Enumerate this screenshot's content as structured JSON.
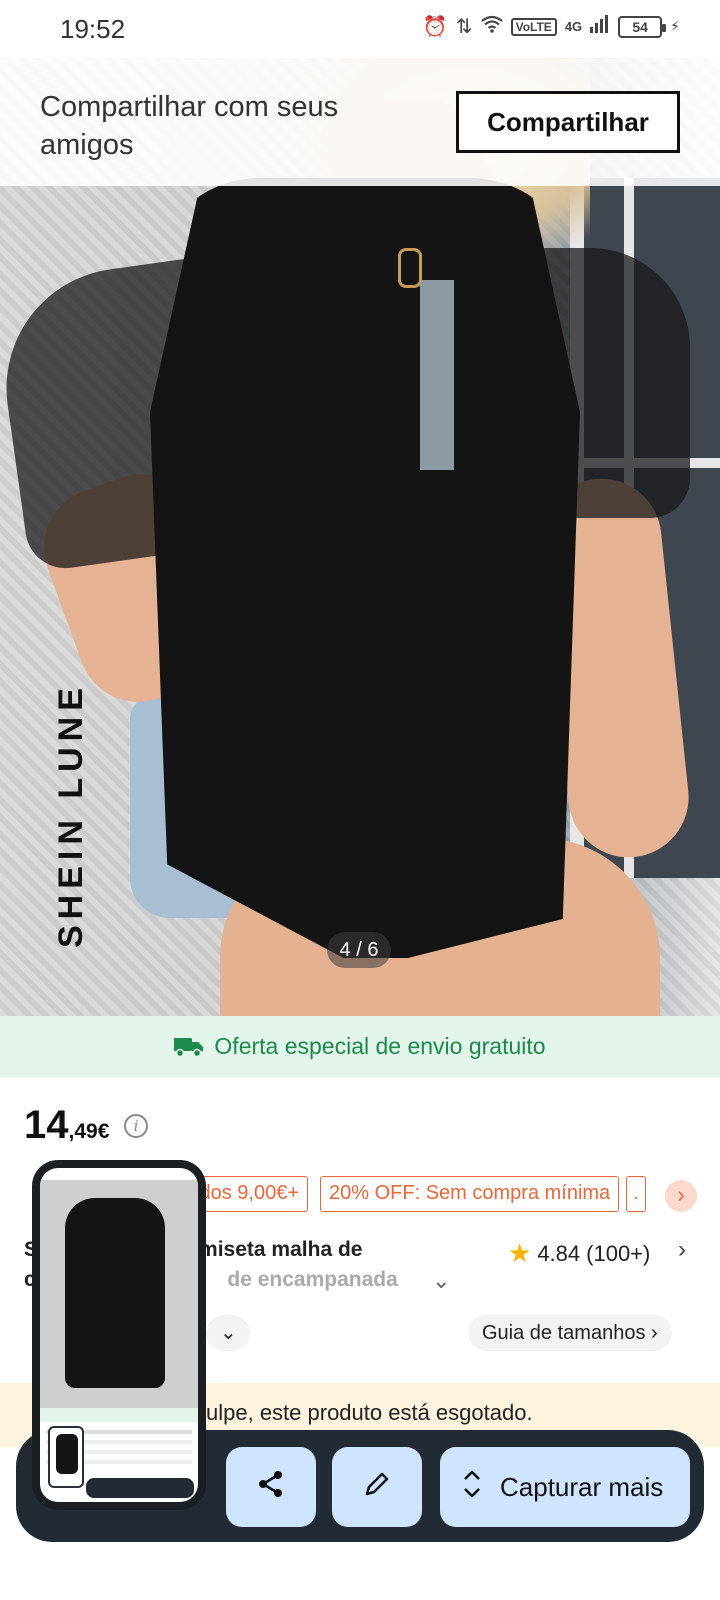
{
  "status_bar": {
    "time": "19:52",
    "network_label": "VoLTE",
    "signal_label": "4G",
    "battery_level": "54"
  },
  "share_overlay": {
    "prompt": "Compartilhar com seus amigos",
    "button_label": "Compartilhar"
  },
  "product_image": {
    "brand_watermark": "SHEIN LUNE",
    "pager": "4 / 6"
  },
  "shipping_banner": {
    "text": "Oferta especial de envio gratuito",
    "icon": "truck-icon",
    "color": "#1c8a4a"
  },
  "price": {
    "integer": "14",
    "decimal": ",49€"
  },
  "coupons": [
    {
      "label": "dos 9,00€+"
    },
    {
      "label": "20% OFF: Sem compra mínima"
    },
    {
      "label": "."
    }
  ],
  "product": {
    "title_line1": "S                    s Camiseta malha de",
    "title_line2_start": "c",
    "title_line2_end": "de encampanada",
    "rating": "4.84",
    "rating_count": "(100+)"
  },
  "chips": {
    "size_prefix": "T",
    "size_guide": "Guia de tamanhos"
  },
  "soldout": {
    "text": "ulpe, este produto está esgotado."
  },
  "toolbar": {
    "capture_more": "Capturar mais"
  },
  "colors": {
    "accent_orange": "#e8673b",
    "toolbar_bg": "#222b33",
    "tool_button_bg": "#cfe5ff",
    "soldout_bg": "#fdf3df"
  }
}
